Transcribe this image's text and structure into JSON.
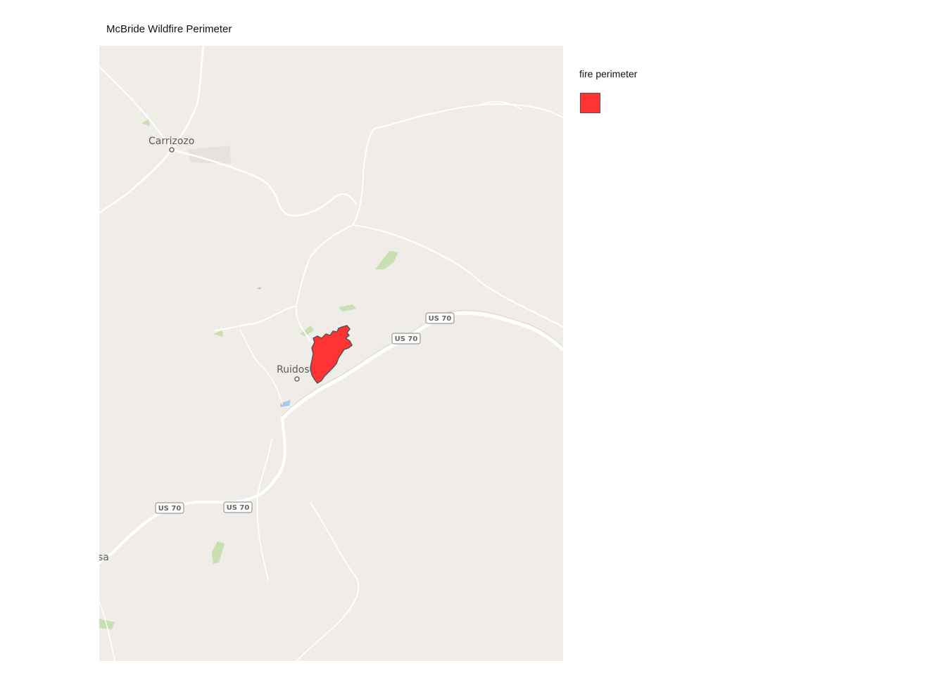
{
  "title": "McBride Wildfire Perimeter",
  "legend": {
    "title": "fire perimeter",
    "swatch_color": "#ff3333",
    "stroke_color": "#555555"
  },
  "map": {
    "background_color": "#f0ede8",
    "road_color": "#ffffff",
    "vegetation_color": "#c8dfb0",
    "water_color": "#a8c8e8",
    "places": {
      "carrizozo": "Carrizozo",
      "ruidoso": "Ruidoso",
      "partial_edge": "sa"
    },
    "route_shields": [
      "US 70",
      "US 70",
      "US 70",
      "US 70"
    ]
  }
}
